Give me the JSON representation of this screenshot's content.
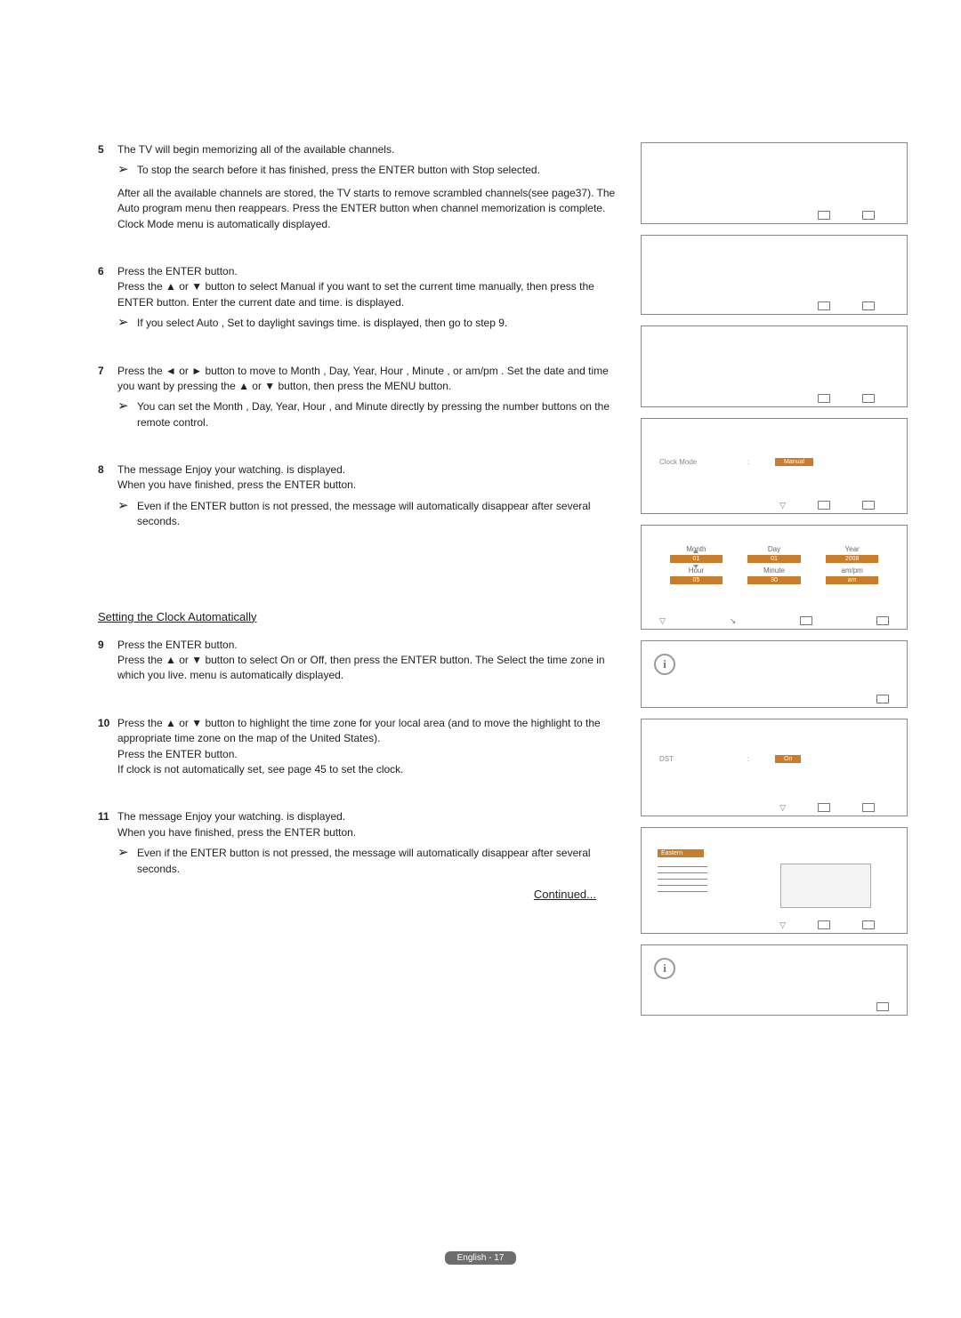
{
  "steps": {
    "s5": {
      "num": "5",
      "intro": "The TV will begin memorizing all of the available channels.",
      "note": "To stop the search before it has finished, press the ENTER button with Stop selected.",
      "after": "After all the available channels are stored, the TV starts to remove scrambled channels(see page37). The Auto program menu then reappears. Press the ENTER button when channel memorization is complete. Clock Mode  menu is automatically displayed."
    },
    "s6": {
      "num": "6",
      "line1": "Press the ENTER button.",
      "line2": "Press the ▲ or ▼ button to select Manual  if you want to set the current time manually, then press the ENTER button. Enter the current date and time.     is displayed.",
      "note": "If you select Auto , Set to daylight savings time.     is displayed, then go to step 9."
    },
    "s7": {
      "num": "7",
      "line1": "Press the ◄ or ► button to move to Month , Day, Year, Hour , Minute , or am/pm . Set the date and time you want by pressing the ▲ or ▼ button, then press the MENU button.",
      "note": "You can set the Month , Day, Year, Hour , and Minute  directly by pressing the number buttons on the remote control."
    },
    "s8": {
      "num": "8",
      "line1": "The message Enjoy your watching.    is displayed.",
      "line2": "When you have finished, press the ENTER button.",
      "note": "Even if the ENTER button is not pressed, the message will automatically disappear after several seconds."
    },
    "s9": {
      "num": "9",
      "header": "Setting the Clock Automatically",
      "line1": "Press the ENTER button.",
      "line2": "Press the ▲ or ▼ button to select On or Off, then press the ENTER button. The Select the time zone in which you live.     menu is automatically displayed."
    },
    "s10": {
      "num": "10",
      "line1": "Press the ▲ or ▼ button to highlight the time zone for your local area (and to move the highlight to the appropriate time zone on the map of the United States).",
      "line2": "Press the ENTER button.",
      "line3": "If clock is not automatically set, see page 45 to set the clock."
    },
    "s11": {
      "num": "11",
      "line1": "The message Enjoy your watching.    is displayed.",
      "line2": "When you have finished, press the ENTER button.",
      "note": "Even if the ENTER button is not pressed, the message will automatically disappear after several seconds."
    }
  },
  "panels": {
    "clockMode": {
      "label": "Clock Mode",
      "colon": ":",
      "value": "Manual"
    },
    "clockSet": {
      "col1": "Month",
      "col2": "Day",
      "col3": "Year",
      "v1": "01",
      "v2": "01",
      "v3": "2008",
      "col4": "Hour",
      "col5": "Minute",
      "col6": "am/pm",
      "v4": "05",
      "v5": "30",
      "v6": "am"
    },
    "dst": {
      "label": "DST",
      "colon": ":",
      "value": "On"
    },
    "tz": {
      "selected": "Eastern"
    }
  },
  "continued": "Continued...",
  "footer": "English - 17",
  "arrowGlyph": "➢"
}
